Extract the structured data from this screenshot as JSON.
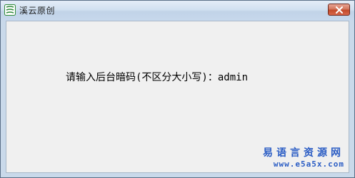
{
  "window": {
    "title": "溪云原创",
    "app_icon": "app-logo-icon",
    "close_icon": "close-icon"
  },
  "main": {
    "prompt": "请输入后台暗码(不区分大小写)：admin"
  },
  "watermark": {
    "site_name": "易语言资源网",
    "url": "www.e5a5x.com"
  },
  "colors": {
    "titlebar": "#c7d8ec",
    "client_bg": "#f0f0f0",
    "close_button": "#c24a2a",
    "watermark": "#2a5cc4"
  }
}
